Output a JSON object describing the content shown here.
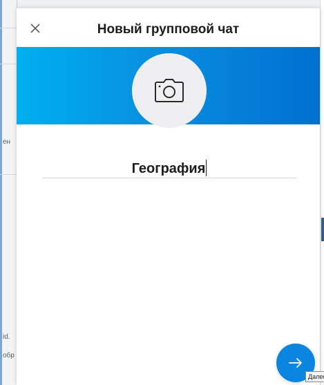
{
  "dialog": {
    "title": "Новый групповой чат",
    "group_name_value": "География"
  },
  "icons": {
    "close": "close-icon",
    "camera": "camera-icon",
    "next": "arrow-right-icon"
  },
  "tooltip": {
    "text": "Далее"
  },
  "background_fragments": {
    "left_1": "ен",
    "left_2": "id.",
    "left_3": "обр"
  },
  "colors": {
    "banner_start": "#00aff0",
    "banner_end": "#0070d0",
    "accent": "#0b86e0"
  }
}
